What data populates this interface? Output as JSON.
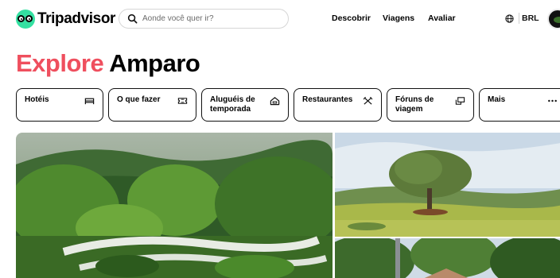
{
  "header": {
    "brand": "Tripadvisor",
    "search": {
      "placeholder": "Aonde você quer ir?",
      "value": ""
    },
    "nav": [
      {
        "label": "Descobrir"
      },
      {
        "label": "Viagens"
      },
      {
        "label": "Avaliar"
      }
    ],
    "currency": "BRL",
    "icons": {
      "logo": "owl-logo-icon",
      "search": "search-icon",
      "language": "globe-icon",
      "profile": "avatar"
    }
  },
  "page": {
    "title_accent": "Explore",
    "title_place": "Amparo"
  },
  "categories": [
    {
      "label": "Hotéis",
      "icon": "bed-icon"
    },
    {
      "label": "O que fazer",
      "icon": "ticket-icon"
    },
    {
      "label": "Aluguéis de temporada",
      "icon": "house-icon"
    },
    {
      "label": "Restaurantes",
      "icon": "fork-knife-icon"
    },
    {
      "label": "Fóruns de viagem",
      "icon": "chat-bubbles-icon"
    },
    {
      "label": "Mais",
      "icon": "more-dots-icon"
    }
  ],
  "colors": {
    "brand_green": "#34e0a1",
    "accent_red": "#ef4f5e",
    "text": "#000000",
    "border": "#111111"
  },
  "gallery": [
    {
      "subject": "garden-photo"
    },
    {
      "subject": "tree-hilltop-photo"
    },
    {
      "subject": "forest-building-photo"
    }
  ]
}
